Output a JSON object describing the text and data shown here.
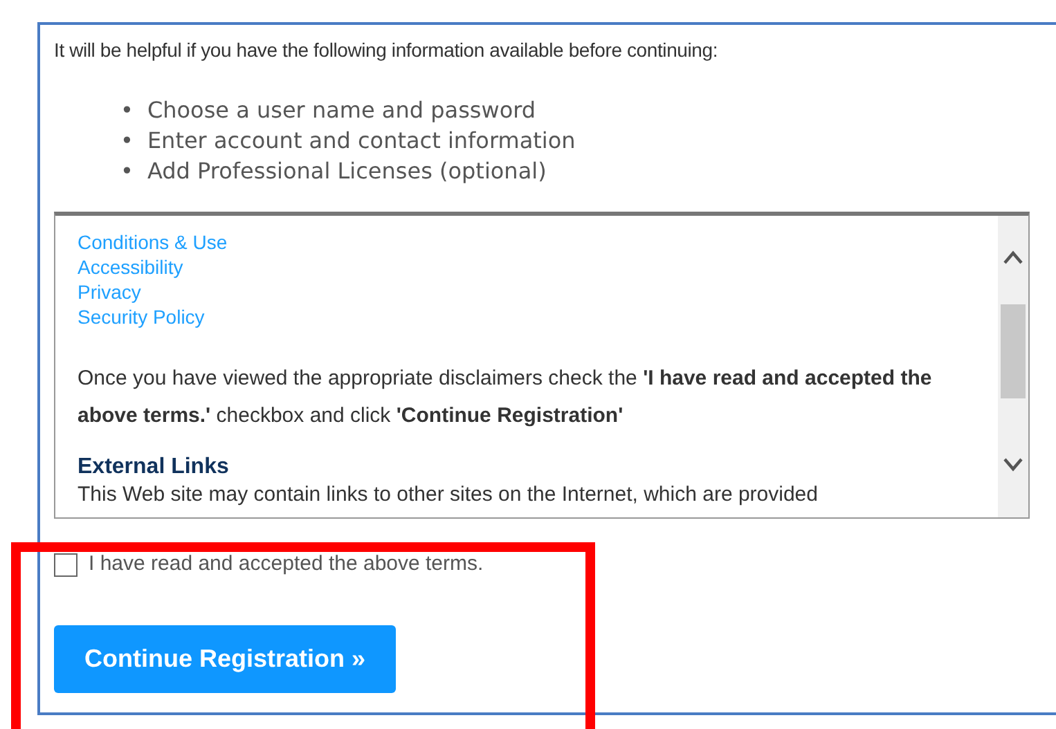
{
  "intro": "It will be helpful if you have the following information available before continuing:",
  "checklist": [
    {
      "marker": "•",
      "text": "Choose a user name and password"
    },
    {
      "marker": "•",
      "text": "Enter account and contact information"
    },
    {
      "marker": "•",
      "text": "Add Professional Licenses (optional)"
    }
  ],
  "terms_box": {
    "links": [
      "Conditions & Use",
      "Accessibility",
      "Privacy",
      "Security Policy"
    ],
    "instruction": "Once you have viewed the appropriate disclaimers check the **'I have read and accepted the above terms.'** checkbox and click **'Continue Registration'**",
    "section_heading": "External Links",
    "section_text": "This Web site may contain links to other sites on the Internet, which are provided"
  },
  "agreement": {
    "label": "I have read and accepted the above terms.",
    "checked": false
  },
  "continue_button": "Continue Registration »",
  "highlight": {
    "color": "#ff0000"
  }
}
